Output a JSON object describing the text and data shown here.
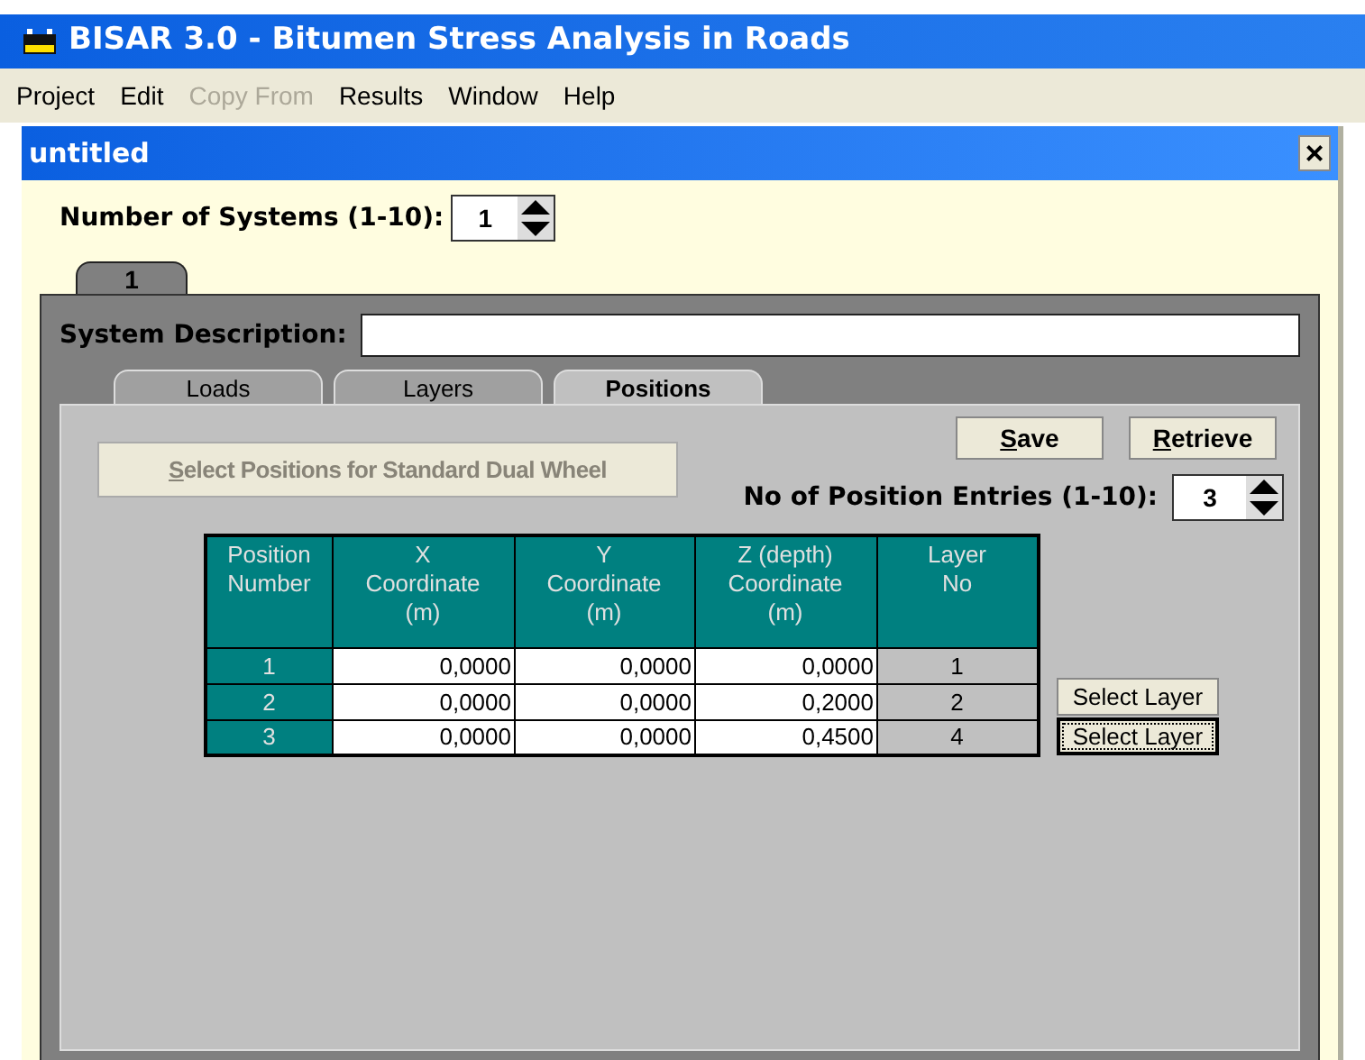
{
  "window": {
    "title": "BISAR 3.0 - Bitumen Stress Analysis in Roads"
  },
  "menu": [
    {
      "label": "Project",
      "disabled": false
    },
    {
      "label": "Edit",
      "disabled": false
    },
    {
      "label": "Copy From",
      "disabled": true
    },
    {
      "label": "Results",
      "disabled": false
    },
    {
      "label": "Window",
      "disabled": false
    },
    {
      "label": "Help",
      "disabled": false
    }
  ],
  "document": {
    "title": "untitled",
    "close": "×"
  },
  "systems": {
    "label": "Number of Systems (1-10):",
    "value": "1"
  },
  "system_tabs": [
    {
      "label": "1",
      "selected": true
    }
  ],
  "system_description": {
    "label": "System Description:"
  },
  "tabs": [
    {
      "label": "Loads",
      "selected": false
    },
    {
      "label": "Layers",
      "selected": false
    },
    {
      "label": "Positions",
      "selected": true
    }
  ],
  "dual_wheel_button": {
    "label": "Select Positions for Standard Dual Wheel",
    "disabled": true,
    "underline_first": true
  },
  "buttons": [
    {
      "label": "Save",
      "underline_first": true
    },
    {
      "label": "Retrieve",
      "underline_first": true
    }
  ],
  "position_entries": {
    "label": "No of Position Entries (1-10):",
    "value": "3"
  },
  "table": {
    "columns": [
      "Position\nNumber",
      "X\nCoordinate\n(m)",
      "Y\nCoordinate\n(m)",
      "Z (depth)\nCoordinate\n(m)",
      "Layer\nNo"
    ],
    "rows": [
      {
        "cells": [
          "1",
          "0,0000",
          "0,0000",
          "0,0000",
          "1"
        ]
      },
      {
        "cells": [
          "2",
          "0,0000",
          "0,0000",
          "0,2000",
          "2"
        ],
        "button": {
          "label": "Select Layer",
          "focused": false
        }
      },
      {
        "cells": [
          "3",
          "0,0000",
          "0,0000",
          "0,4500",
          "4"
        ],
        "button": {
          "label": "Select Layer",
          "focused": true
        }
      }
    ]
  }
}
